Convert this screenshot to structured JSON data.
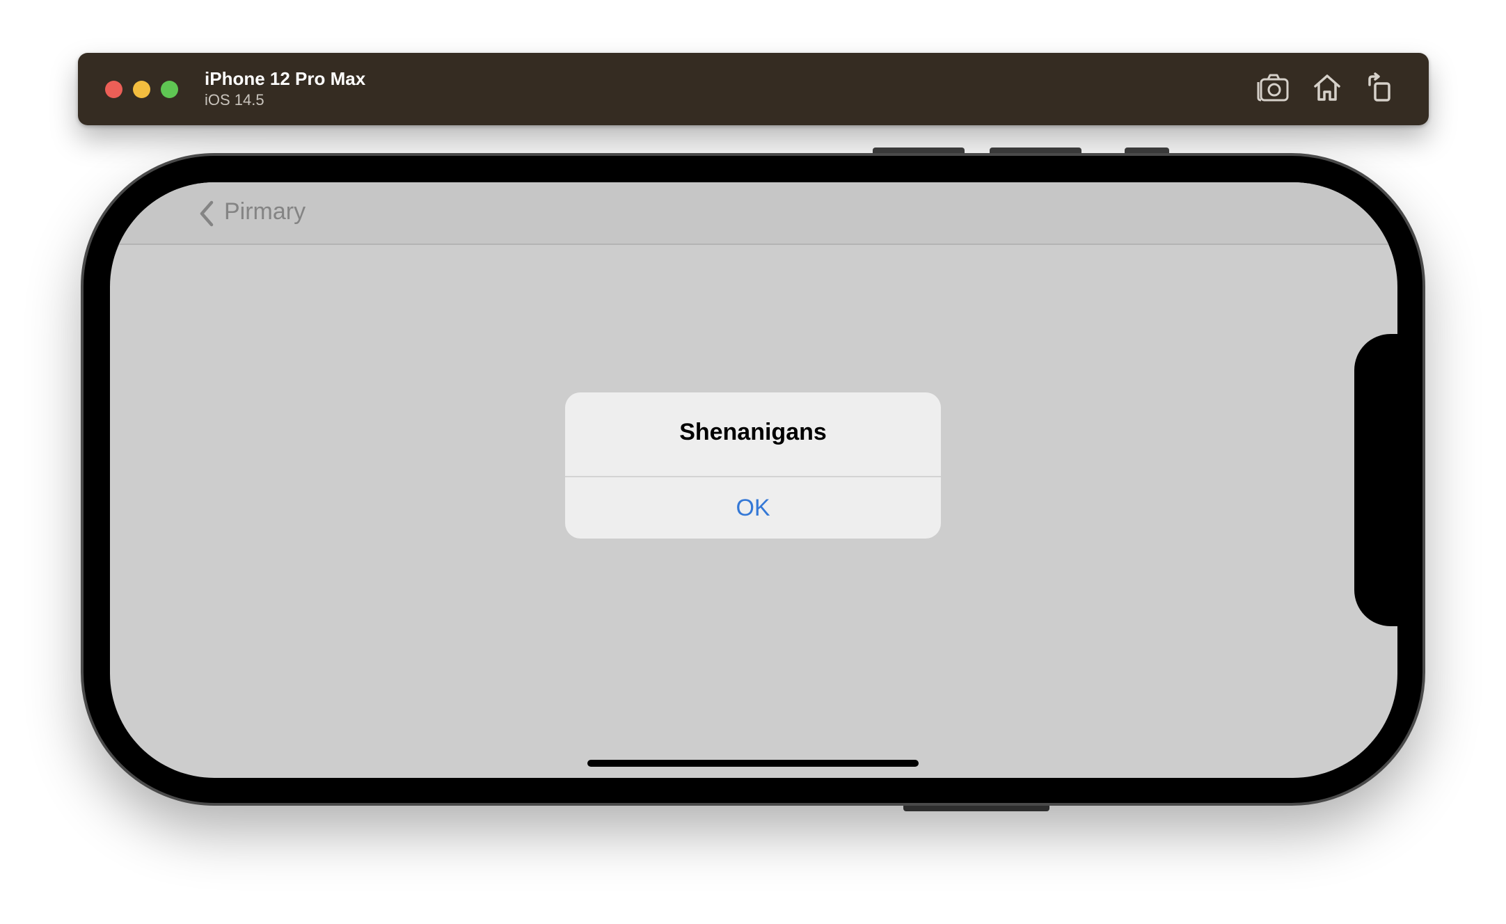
{
  "window": {
    "device_name": "iPhone 12 Pro Max",
    "os_version": "iOS 14.5",
    "toolbar_icons": [
      "screenshot-icon",
      "home-icon",
      "rotate-icon"
    ]
  },
  "navigation": {
    "back_label": "Pirmary"
  },
  "alert": {
    "title": "Shenanigans",
    "button_label": "OK"
  },
  "colors": {
    "titlebar": "#352c22",
    "close": "#ec5f57",
    "minimize": "#f3bd3f",
    "zoom": "#5fc653",
    "screen_background": "#cdcdcd",
    "alert_background": "#eeeeee",
    "ios_blue": "#3478d6"
  }
}
